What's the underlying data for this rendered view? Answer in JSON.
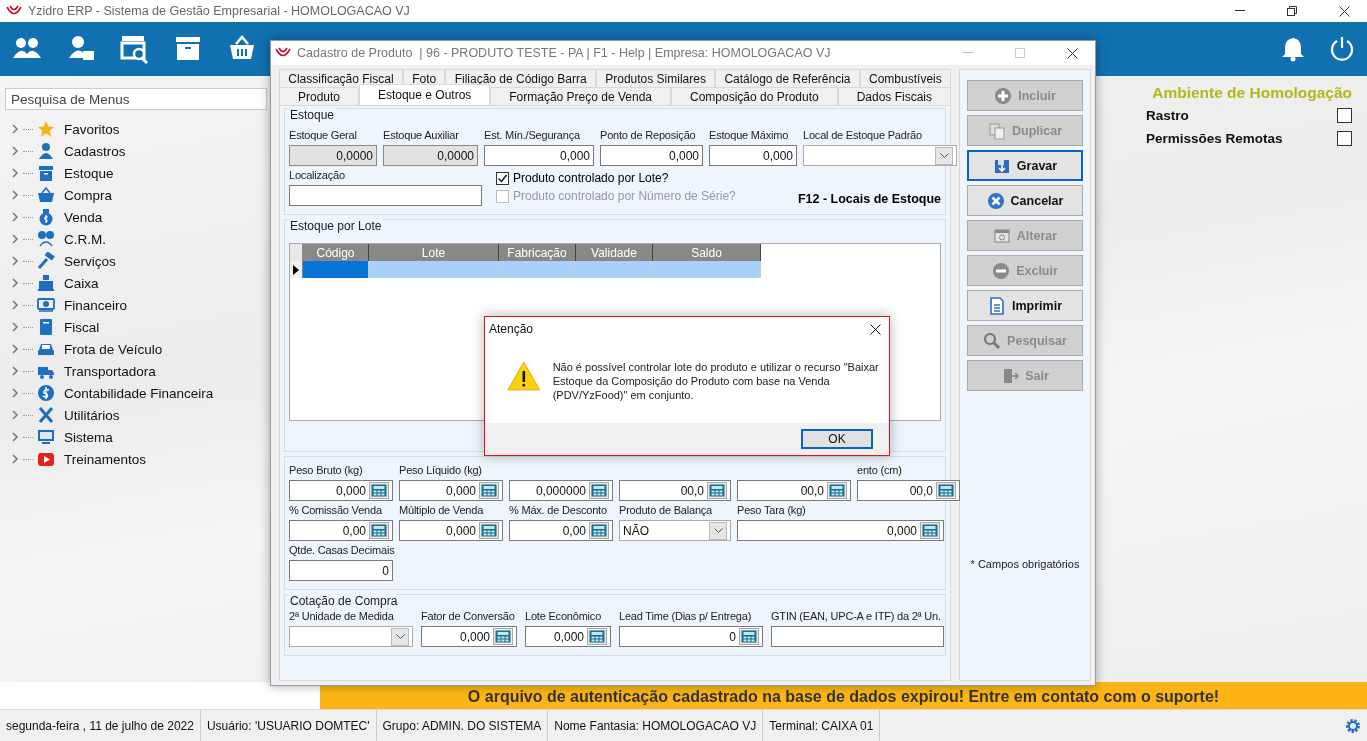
{
  "app_title": "Yzidro ERP - Sistema de Gestão Empresarial - HOMOLOGACAO VJ",
  "menu_search": {
    "placeholder": "Pesquisa de Menus"
  },
  "menu": [
    {
      "label": "Favoritos",
      "expanded": false
    },
    {
      "label": "Cadastros",
      "expanded": false
    },
    {
      "label": "Estoque",
      "expanded": false
    },
    {
      "label": "Compra",
      "expanded": false
    },
    {
      "label": "Venda",
      "expanded": false
    },
    {
      "label": "C.R.M.",
      "expanded": false
    },
    {
      "label": "Serviços",
      "expanded": false
    },
    {
      "label": "Caixa",
      "expanded": false
    },
    {
      "label": "Financeiro",
      "expanded": false
    },
    {
      "label": "Fiscal",
      "expanded": false
    },
    {
      "label": "Frota de Veículo",
      "expanded": false
    },
    {
      "label": "Transportadora",
      "expanded": false
    },
    {
      "label": "Contabilidade Financeira",
      "expanded": false
    },
    {
      "label": "Utilitários",
      "expanded": false
    },
    {
      "label": "Sistema",
      "expanded": false
    },
    {
      "label": "Treinamentos",
      "expanded": false
    }
  ],
  "environment": {
    "title": "Ambiente de Homologação",
    "options": [
      {
        "label": "Rastro",
        "checked": false
      },
      {
        "label": "Permissões Remotas",
        "checked": false
      }
    ]
  },
  "banner": "O arquivo de autenticação cadastrado na base de dados expirou! Entre em contato com o suporte!",
  "status_bar": [
    "segunda-feira , 11 de julho de 2022",
    "Usuário: 'USUARIO DOMTEC'",
    "Grupo: ADMIN. DO SISTEMA",
    "Nome Fantasia: HOMOLOGACAO VJ",
    "Terminal: CAIXA 01"
  ],
  "product_window": {
    "title": "Cadastro de Produto  | 96 - PRODUTO TESTE - PA | F1 - Help | Empresa: HOMOLOGACAO VJ",
    "tab_rows": [
      [
        {
          "label": "Classificação Fiscal",
          "selected": false
        },
        {
          "label": "Foto",
          "selected": false
        },
        {
          "label": "Filiação de Código Barra",
          "selected": false
        },
        {
          "label": "Produtos Similares",
          "selected": false
        },
        {
          "label": "Catálogo de Referência",
          "selected": false
        },
        {
          "label": "Combustíveis",
          "selected": false
        }
      ],
      [
        {
          "label": "Produto",
          "selected": false
        },
        {
          "label": "Estoque e Outros",
          "selected": true
        },
        {
          "label": "Formação Preço de Venda",
          "selected": false
        },
        {
          "label": "Composição do Produto",
          "selected": false
        },
        {
          "label": "Dados Fiscais",
          "selected": false
        }
      ]
    ],
    "stock": {
      "legend": "Estoque",
      "fields": [
        {
          "label": "Estoque Geral",
          "value": "0,0000",
          "kind": "readonly"
        },
        {
          "label": "Estoque Auxiliar",
          "value": "0,0000",
          "kind": "readonly"
        },
        {
          "label": "Est. Mín./Segurança",
          "value": "0,000",
          "kind": "number"
        },
        {
          "label": "Ponto de Reposição",
          "value": "0,000",
          "kind": "number"
        },
        {
          "label": "Estoque Máximo",
          "value": "0,000",
          "kind": "number"
        },
        {
          "label": "Local de Estoque Padrão",
          "kind": "select"
        }
      ],
      "location": {
        "label": "Localização",
        "kind": "text"
      },
      "checkboxes": [
        {
          "label": "Produto controlado por Lote?",
          "checked": true,
          "disabled": false
        },
        {
          "label": "Produto controlado por Número de Série?",
          "checked": false,
          "disabled": true
        }
      ],
      "shortcut": "F12 - Locais de Estoque"
    },
    "lots": {
      "legend": "Estoque por Lote",
      "columns": [
        "Código",
        "Lote",
        "Fabricação",
        "Validade",
        "Saldo"
      ],
      "rows": [
        {
          "selected": true
        }
      ]
    },
    "measures": [
      [
        {
          "label": "Peso Bruto (kg)",
          "value": "0,000",
          "kind": "calc"
        },
        {
          "label": "Peso Líquido (kg)",
          "value": "0,000",
          "kind": "calc"
        },
        {
          "value": "0,000000",
          "kind": "calc"
        },
        {
          "value": "00,0",
          "kind": "calc"
        },
        {
          "value": "00,0",
          "kind": "calc"
        },
        {
          "label": "ento (cm)",
          "value": "00,0",
          "kind": "calc"
        }
      ],
      [
        {
          "label": "% Comissão Venda",
          "value": "0,00",
          "kind": "calc"
        },
        {
          "label": "Múltiplo de Venda",
          "value": "0,000",
          "kind": "calc"
        },
        {
          "label": "% Máx. de Desconto",
          "value": "0,00",
          "kind": "calc"
        },
        {
          "label": "Produto de Balança",
          "value": "NÃO",
          "kind": "select"
        },
        {
          "label": "Peso Tara (kg)",
          "value": "0,000",
          "kind": "calc"
        }
      ],
      [
        {
          "label": "Qtde. Casas Decimais",
          "value": "0",
          "kind": "number"
        }
      ]
    ],
    "purchase_quote": {
      "legend": "Cotação de Compra",
      "fields": [
        {
          "label": "2ª Unidade de Medida",
          "kind": "select"
        },
        {
          "label": "Fator de Conversão",
          "value": "0,000",
          "kind": "calc"
        },
        {
          "label": "Lote Econômico",
          "value": "0,000",
          "kind": "calc"
        },
        {
          "label": "Lead Time (Dias p/ Entrega)",
          "value": "0",
          "kind": "calc"
        },
        {
          "label": "GTIN (EAN, UPC-A e ITF) da 2ª Un.",
          "kind": "text"
        }
      ]
    },
    "actions": [
      {
        "label": "Incluir",
        "disabled": true,
        "focused": false
      },
      {
        "label": "Duplicar",
        "disabled": true,
        "focused": false
      },
      {
        "label": "Gravar",
        "disabled": false,
        "focused": true
      },
      {
        "label": "Cancelar",
        "disabled": false,
        "focused": false
      },
      {
        "label": "Alterar",
        "disabled": true,
        "focused": false
      },
      {
        "label": "Excluir",
        "disabled": true,
        "focused": false
      },
      {
        "label": "Imprimir",
        "disabled": false,
        "focused": false
      },
      {
        "label": "Pesquisar",
        "disabled": true,
        "focused": false
      },
      {
        "label": "Sair",
        "disabled": true,
        "focused": false
      }
    ],
    "required_note": "* Campos obrigatórios"
  },
  "alert": {
    "title": "Atenção",
    "message": "Não é possível controlar lote do produto e utilizar o recurso \"Baixar Estoque da Composição do Produto com base na Venda (PDV/YzFood)\" em conjunto.",
    "button": "OK"
  }
}
